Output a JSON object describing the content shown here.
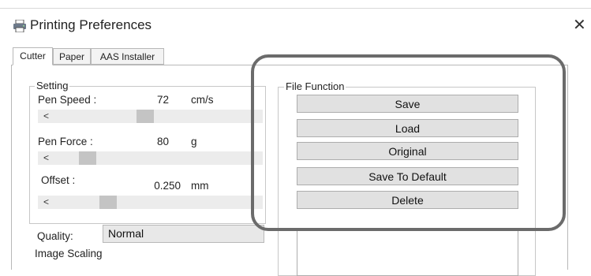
{
  "window": {
    "title": "Printing Preferences",
    "close_glyph": "✕",
    "icon": "printer-icon"
  },
  "tabs": [
    {
      "label": "Cutter",
      "active": true
    },
    {
      "label": "Paper",
      "active": false
    },
    {
      "label": "AAS Installer",
      "active": false
    }
  ],
  "setting": {
    "group_label": "Setting",
    "pen_speed": {
      "label": "Pen Speed :",
      "value": "72",
      "unit": "cm/s"
    },
    "pen_force": {
      "label": "Pen Force :",
      "value": "80",
      "unit": "g"
    },
    "offset": {
      "label": "Offset :",
      "value": "0.250",
      "unit": "mm"
    },
    "slider_left_glyph": "<",
    "quality": {
      "label": "Quality:",
      "value": "Normal"
    },
    "image_scaling_label": "Image Scaling"
  },
  "file_function": {
    "group_label": "File Function",
    "buttons": [
      "Save",
      "Load",
      "Original",
      "Save To Default",
      "Delete"
    ]
  },
  "colors": {
    "highlight_border": "#6b6b6b",
    "button_bg": "#e1e1e1"
  }
}
